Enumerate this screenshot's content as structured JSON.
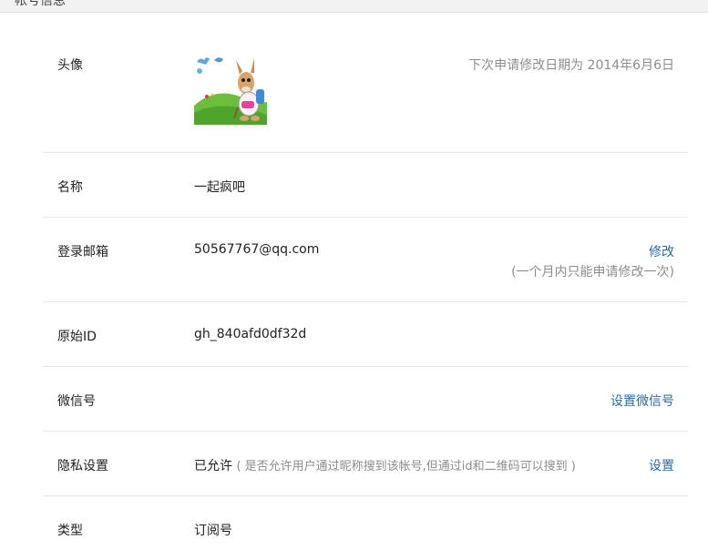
{
  "header": {
    "title": "帐号信息"
  },
  "avatar_row": {
    "label": "头像",
    "next_change_note": "下次申请修改日期为 2014年6月6日"
  },
  "name_row": {
    "label": "名称",
    "value": "一起疯吧"
  },
  "email_row": {
    "label": "登录邮箱",
    "value": "50567767@qq.com",
    "action": "修改",
    "note": "(一个月内只能申请修改一次)"
  },
  "id_row": {
    "label": "原始ID",
    "value": "gh_840afd0df32d"
  },
  "wechat_row": {
    "label": "微信号",
    "action": "设置微信号"
  },
  "privacy_row": {
    "label": "隐私设置",
    "status": "已允许",
    "hint": "( 是否允许用户通过昵称搜到该帐号,但通过id和二维码可以搜到 )",
    "action": "设置"
  },
  "type_row": {
    "label": "类型",
    "value": "订阅号"
  },
  "colors": {
    "link": "#2b6aa0",
    "muted": "#8d8d8d",
    "divider": "#e7e7e7"
  },
  "icons": {
    "avatar": "cartoon-donkey-avatar"
  }
}
